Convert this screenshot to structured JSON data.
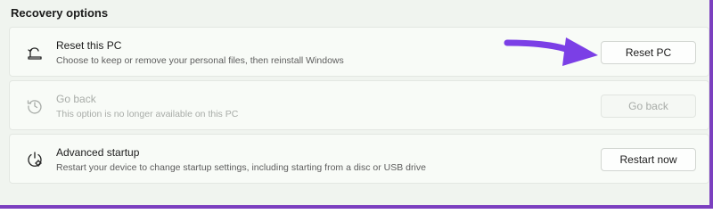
{
  "section": {
    "title": "Recovery options"
  },
  "options": [
    {
      "title": "Reset this PC",
      "description": "Choose to keep or remove your personal files, then reinstall Windows",
      "button": "Reset PC",
      "enabled": true,
      "icon": "reset-pc-icon"
    },
    {
      "title": "Go back",
      "description": "This option is no longer available on this PC",
      "button": "Go back",
      "enabled": false,
      "icon": "history-icon"
    },
    {
      "title": "Advanced startup",
      "description": "Restart your device to change startup settings, including starting from a disc or USB drive",
      "button": "Restart now",
      "enabled": true,
      "icon": "advanced-startup-icon"
    }
  ],
  "colors": {
    "annotation_arrow": "#7b3fe6",
    "frame_border": "#7b3fbf"
  }
}
